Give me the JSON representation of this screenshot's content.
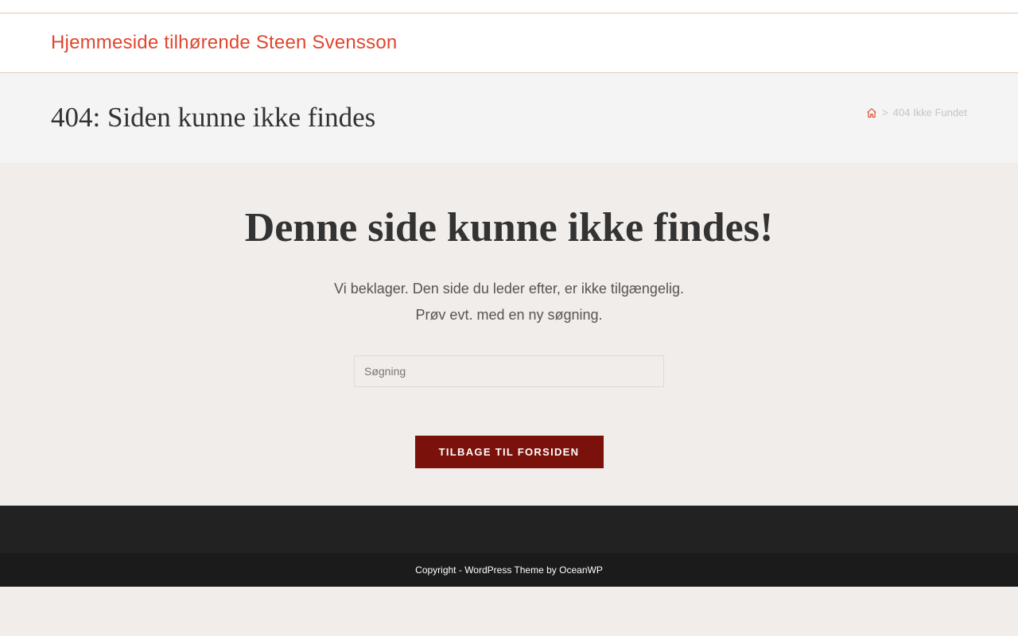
{
  "site": {
    "title": "Hjemmeside tilhørende Steen Svensson"
  },
  "page_header": {
    "title": "404: Siden kunne ikke findes",
    "breadcrumb": {
      "home_icon": "home-icon",
      "separator": ">",
      "current": "404 Ikke Fundet"
    }
  },
  "main": {
    "heading": "Denne side kunne ikke findes!",
    "message_line1": "Vi beklager. Den side du leder efter, er ikke tilgængelig.",
    "message_line2": "Prøv evt. med en ny søgning.",
    "search": {
      "placeholder": "Søgning",
      "value": ""
    },
    "back_button_label": "Tilbage til forsiden"
  },
  "footer": {
    "copyright_prefix": "Copyright - ",
    "theme_link": "WordPress Theme",
    "by": " by ",
    "author_link": "OceanWP"
  },
  "colors": {
    "accent": "#e0462f",
    "button": "#7a120b",
    "background": "#f0edea",
    "footer": "#222222"
  }
}
